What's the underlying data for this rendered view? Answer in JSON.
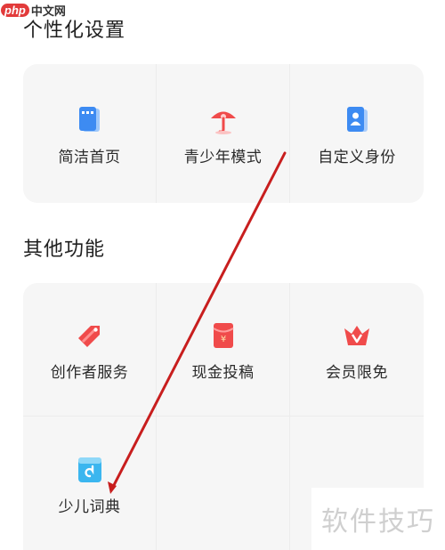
{
  "logo": {
    "badge": "php",
    "site": "中文网"
  },
  "personalization": {
    "title": "个性化设置",
    "items": [
      {
        "label": "简洁首页",
        "icon": "document-icon"
      },
      {
        "label": "青少年模式",
        "icon": "umbrella-icon"
      },
      {
        "label": "自定义身份",
        "icon": "id-card-icon"
      }
    ]
  },
  "other": {
    "title": "其他功能",
    "items": [
      {
        "label": "创作者服务",
        "icon": "tag-icon"
      },
      {
        "label": "现金投稿",
        "icon": "red-envelope-icon"
      },
      {
        "label": "会员限免",
        "icon": "crown-icon"
      },
      {
        "label": "少儿词典",
        "icon": "dictionary-icon"
      }
    ]
  },
  "watermark": "软件技巧",
  "colors": {
    "card_bg": "#f6f6f6",
    "accent_blue": "#3d8bf2",
    "accent_red": "#f04b4b",
    "annotation_arrow": "#c81e1e"
  }
}
